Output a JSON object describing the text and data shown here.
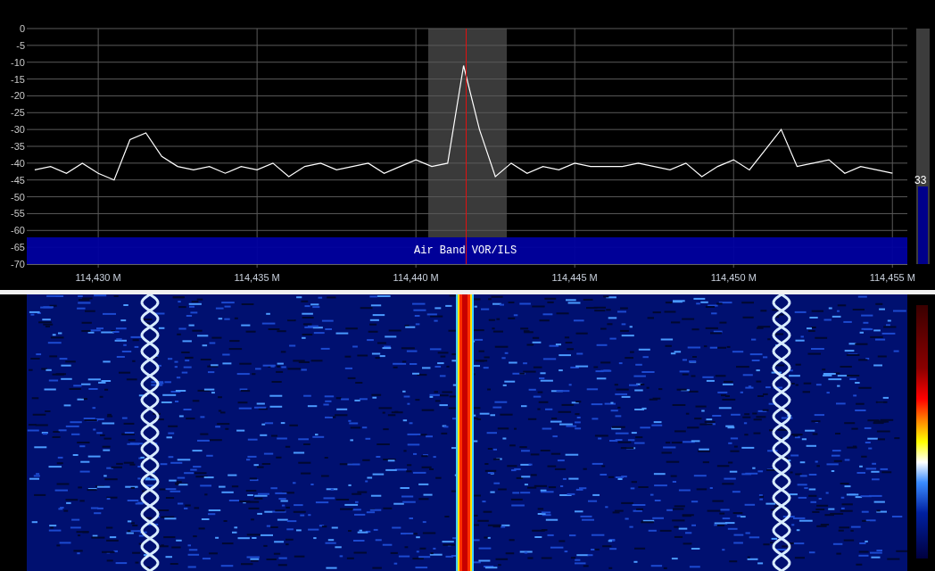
{
  "spectrum": {
    "chart_data": {
      "type": "line",
      "xlim": [
        114427.75,
        114455.47
      ],
      "ylim": [
        -70,
        0
      ],
      "grid": true,
      "yticks": [
        0,
        -5,
        -10,
        -15,
        -20,
        -25,
        -30,
        -35,
        -40,
        -45,
        -50,
        -55,
        -60,
        -65,
        -70
      ],
      "xticks": [
        {
          "value": 114430,
          "label": "114,430 M"
        },
        {
          "value": 114435,
          "label": "114,435 M"
        },
        {
          "value": 114440,
          "label": "114,440 M"
        },
        {
          "value": 114445,
          "label": "114,445 M"
        },
        {
          "value": 114450,
          "label": "114,450 M"
        },
        {
          "value": 114455,
          "label": "114,455 M"
        }
      ],
      "x": [
        114428,
        114428.5,
        114429,
        114429.5,
        114430,
        114430.5,
        114431,
        114431.5,
        114432,
        114432.5,
        114433,
        114433.5,
        114434,
        114434.5,
        114435,
        114435.5,
        114436,
        114436.5,
        114437,
        114437.5,
        114438,
        114438.5,
        114439,
        114439.5,
        114440,
        114440.5,
        114441,
        114441.5,
        114442,
        114442.5,
        114443,
        114443.5,
        114444,
        114444.5,
        114445,
        114445.5,
        114446,
        114446.5,
        114447,
        114447.5,
        114448,
        114448.5,
        114449,
        114449.5,
        114450,
        114450.5,
        114451,
        114451.5,
        114452,
        114452.5,
        114453,
        114453.5,
        114454,
        114454.5,
        114455
      ],
      "series": [
        {
          "color": "#ffffff",
          "values": [
            -42,
            -41,
            -43,
            -40,
            -43,
            -45,
            -33,
            -31,
            -38,
            -41,
            -42,
            -41,
            -43,
            -41,
            -42,
            -40,
            -44,
            -41,
            -40,
            -42,
            -41,
            -40,
            -43,
            -41,
            -39,
            -41,
            -40,
            -11,
            -30,
            -44,
            -40,
            -43,
            -41,
            -42,
            -40,
            -41,
            -41,
            -41,
            -40,
            -41,
            -42,
            -40,
            -44,
            -41,
            -39,
            -42,
            -36,
            -30,
            -41,
            -40,
            -39,
            -43,
            -41,
            -42,
            -43
          ]
        }
      ]
    },
    "band": {
      "label": "Air Band VOR/ILS"
    }
  },
  "meter": {
    "level": 0.33,
    "reading": "33"
  }
}
